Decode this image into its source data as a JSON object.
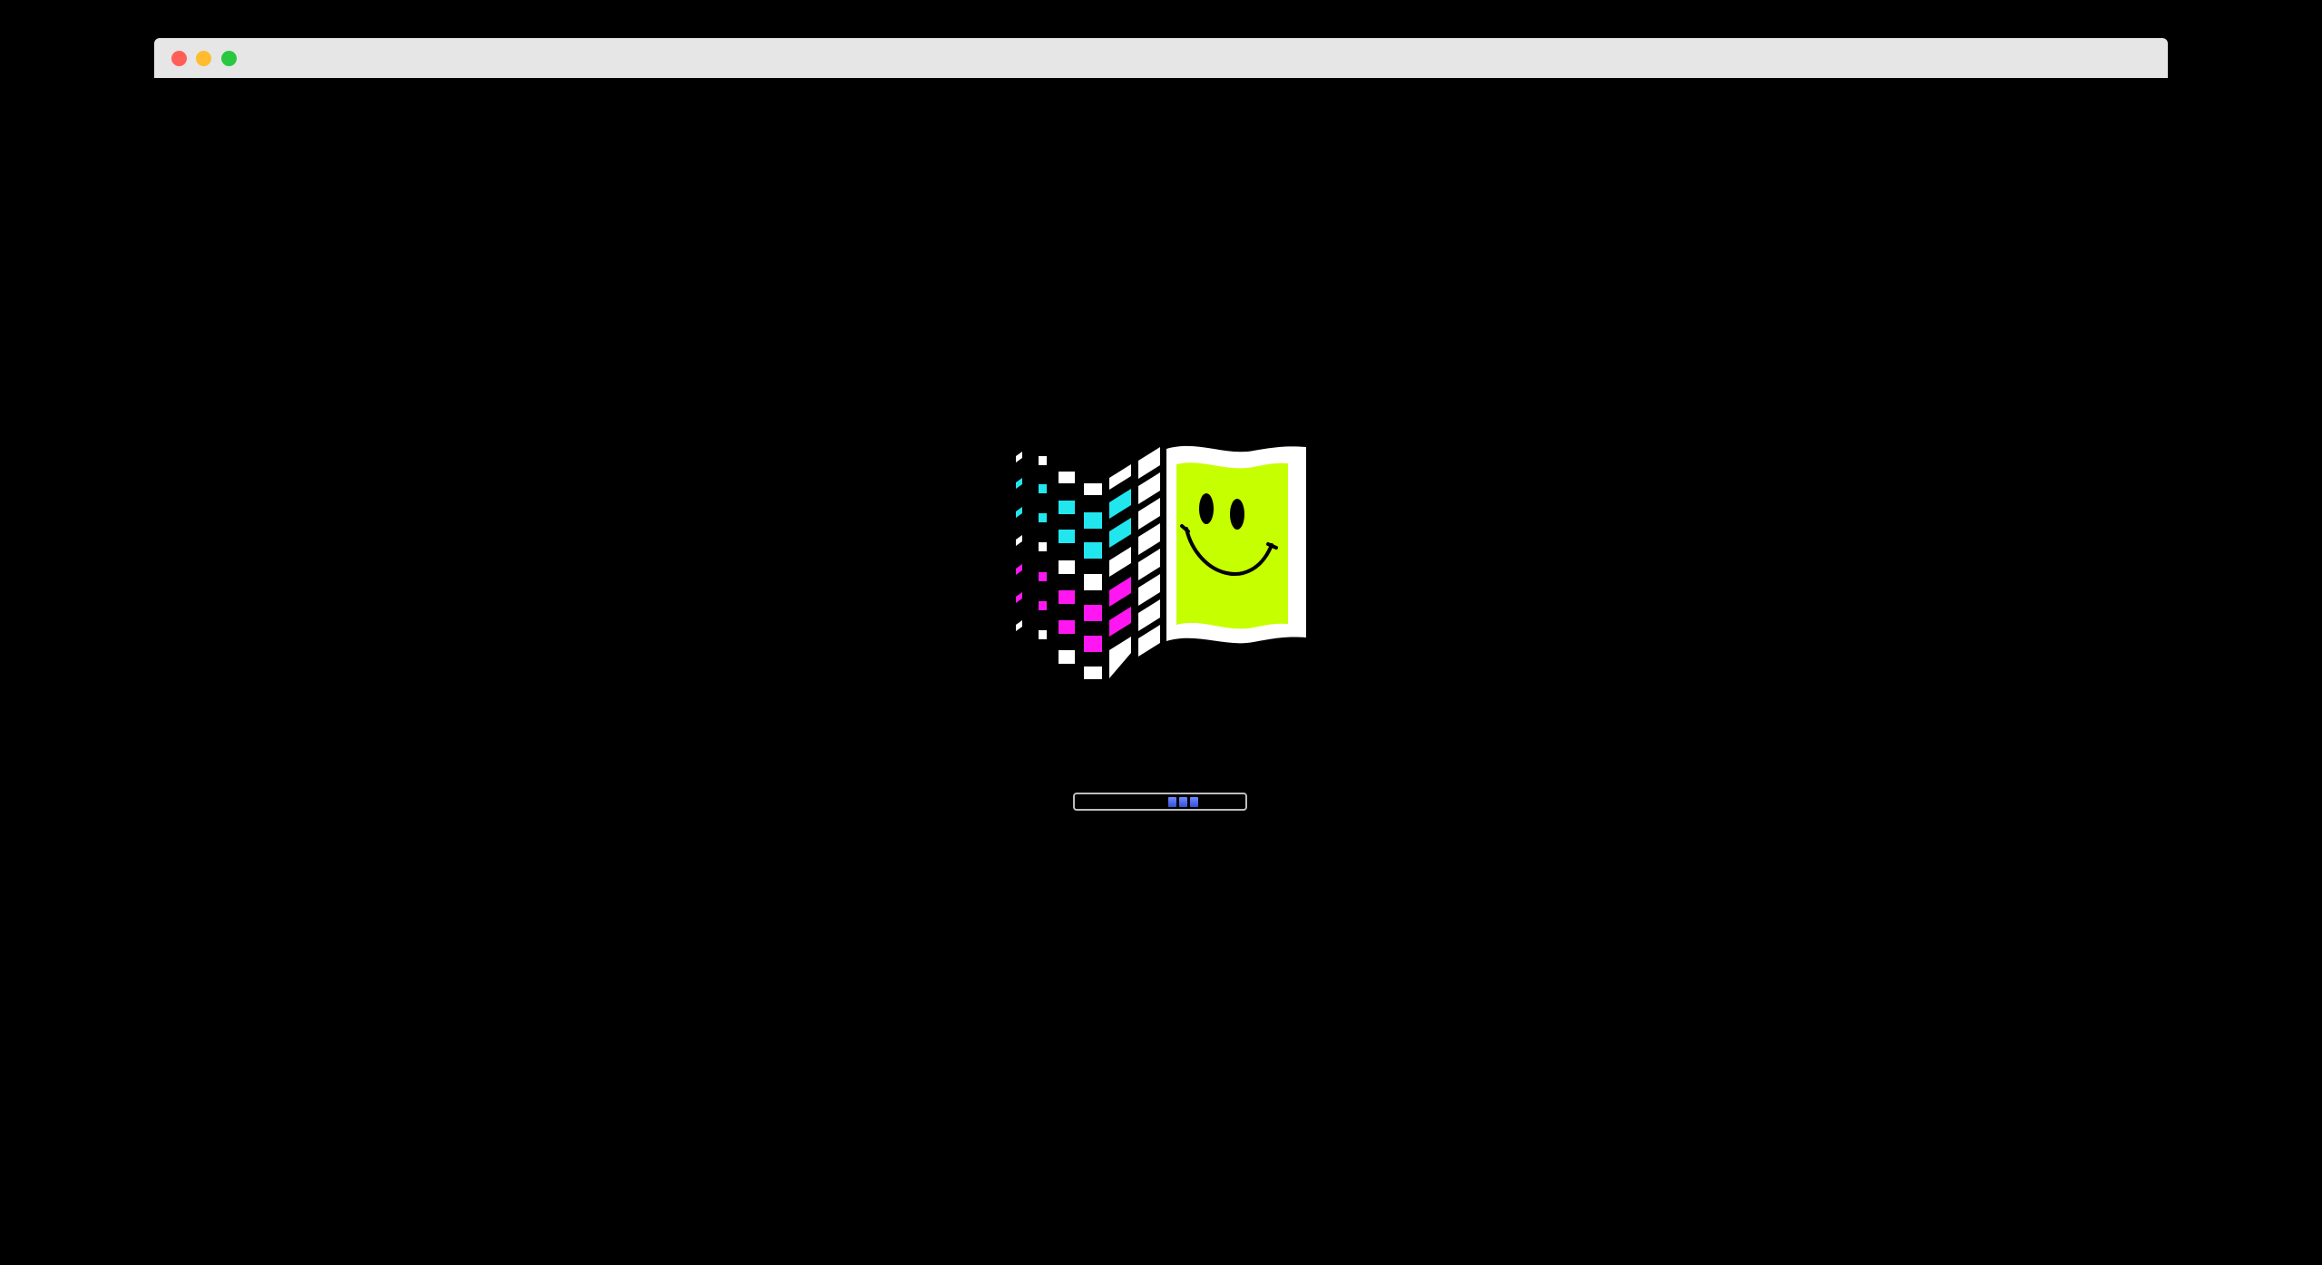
{
  "window": {
    "controls": [
      {
        "name": "close-button",
        "color": "#ff5f57"
      },
      {
        "name": "minimize-button",
        "color": "#febc2e"
      },
      {
        "name": "maximize-button",
        "color": "#28c840"
      }
    ]
  },
  "boot": {
    "logo_icon": "windows-flag-smiley-icon",
    "background": "#000000",
    "flag_colors": {
      "cyan": "#22e6ee",
      "magenta": "#ff16f0",
      "white": "#ffffff",
      "lime": "#c6ff00",
      "face": "#000000"
    },
    "progress": {
      "blocks": 3,
      "block_color": "#4a66ee",
      "track_border": "#bdbdbd",
      "state": "indeterminate"
    }
  }
}
